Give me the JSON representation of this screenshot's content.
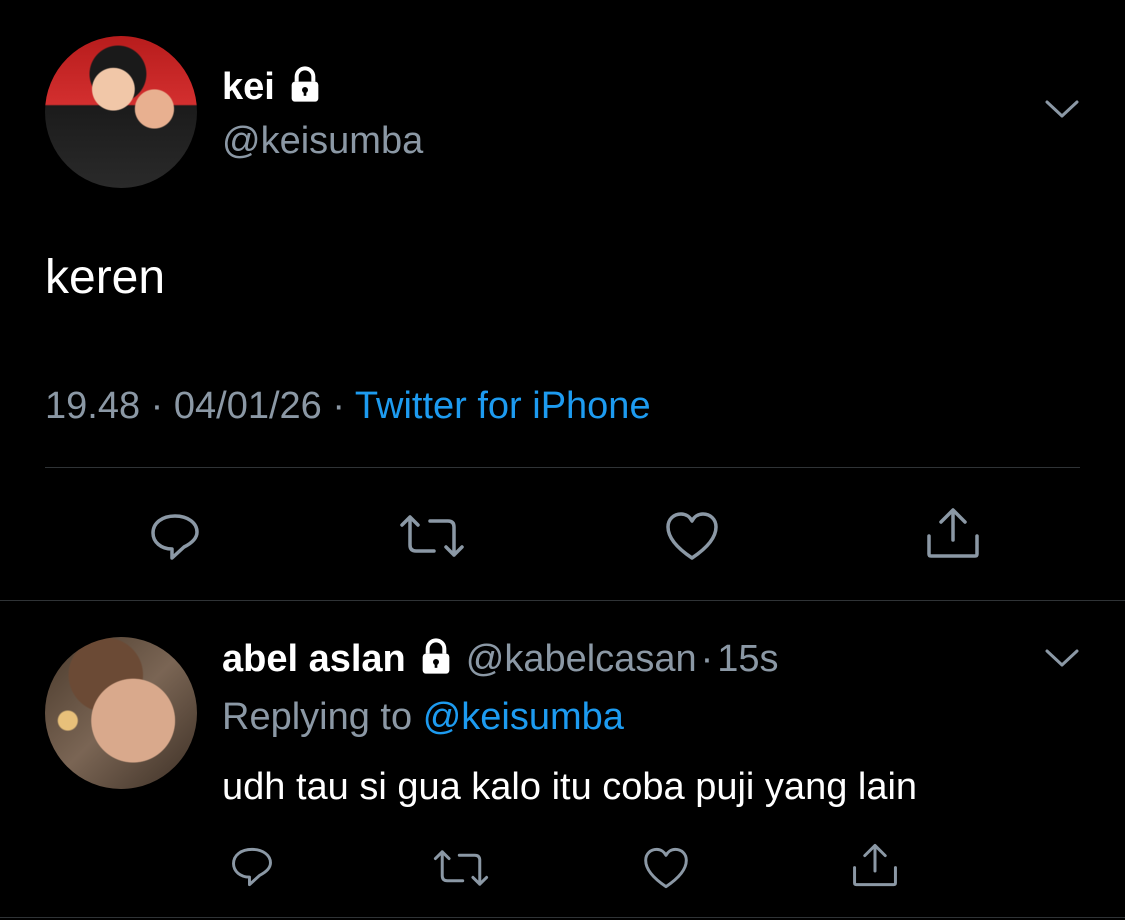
{
  "tweet": {
    "name": "kei",
    "handle": "@keisumba",
    "text": "keren",
    "time": "19.48",
    "date": "04/01/26",
    "separator": "·",
    "source": "Twitter for iPhone"
  },
  "reply": {
    "name": "abel aslan",
    "handle": "@kabelcasan",
    "separator": "·",
    "time": "15s",
    "replying_label": "Replying to",
    "replying_handle": "@keisumba",
    "text": "udh tau si gua kalo itu coba puji yang lain"
  },
  "colors": {
    "background": "#000000",
    "muted": "#8b98a5",
    "link": "#1d9bf0",
    "divider": "#2f3336"
  },
  "icons": [
    "lock-icon",
    "chevron-down-icon",
    "reply-icon",
    "retweet-icon",
    "like-icon",
    "share-icon"
  ]
}
